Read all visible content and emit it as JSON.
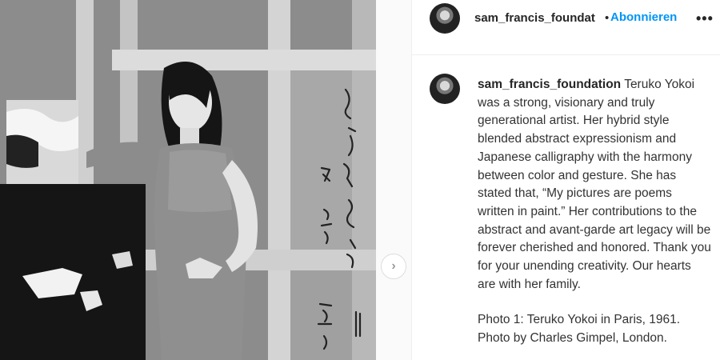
{
  "post": {
    "photo_alt": "Teruko Yokoi in Paris, 1961",
    "next_icon": "chevron-right-icon"
  },
  "header": {
    "username": "sam_francis_foundat",
    "separator": "•",
    "follow_label": "Abonnieren",
    "more_label": "•••"
  },
  "caption": {
    "username": "sam_francis_foundation",
    "text": "Teruko Yokoi was a strong, visionary and truly generational artist. Her hybrid style blended abstract expressionism and Japanese calligraphy with the harmony between color and gesture. She has stated that, “My pictures are poems written in paint.” Her contributions to the abstract and avant-garde art legacy will be forever cherished and honored. Thank you for your unending creativity. Our hearts are with her family.",
    "photo_credit_line1": "Photo 1: Teruko Yokoi in Paris, 1961.",
    "photo_credit_line2": "Photo by Charles Gimpel, London."
  },
  "colors": {
    "accent": "#0095f6",
    "text": "#262626"
  }
}
